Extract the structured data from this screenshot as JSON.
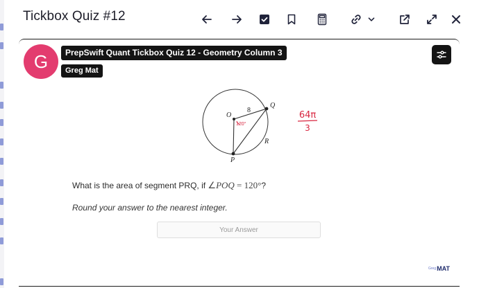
{
  "header": {
    "title": "Tickbox Quiz #12"
  },
  "toolbar": {
    "icons": [
      "arrow-left-icon",
      "arrow-right-icon",
      "checkbox-icon",
      "bookmark-icon",
      "calculator-icon",
      "link-icon",
      "chevron-down-icon",
      "external-link-icon",
      "expand-icon",
      "close-icon"
    ]
  },
  "video": {
    "avatar_letter": "G",
    "avatar_color": "#e33c6f",
    "title": "PrepSwift Quant Tickbox Quiz 12 - Geometry Column 3",
    "channel": "Greg Mat"
  },
  "diagram": {
    "labels": {
      "center": "O",
      "radius": "8",
      "point_q": "Q",
      "point_p": "P",
      "arc": "R",
      "angle_note": "120°"
    },
    "handwritten_note": {
      "numerator": "64π",
      "denominator": "3"
    },
    "ink_color": "#d8253f"
  },
  "question": {
    "prefix": "What is the area of segment PRQ, if ",
    "angle_symbol": "∠",
    "angle_name": "POQ",
    "equals": " = ",
    "angle_value": "120°",
    "suffix": "?",
    "instruction": "Round your answer to the nearest integer."
  },
  "answer": {
    "placeholder": "Your Answer"
  },
  "brand": {
    "small": "Greg",
    "main": "MAT"
  }
}
